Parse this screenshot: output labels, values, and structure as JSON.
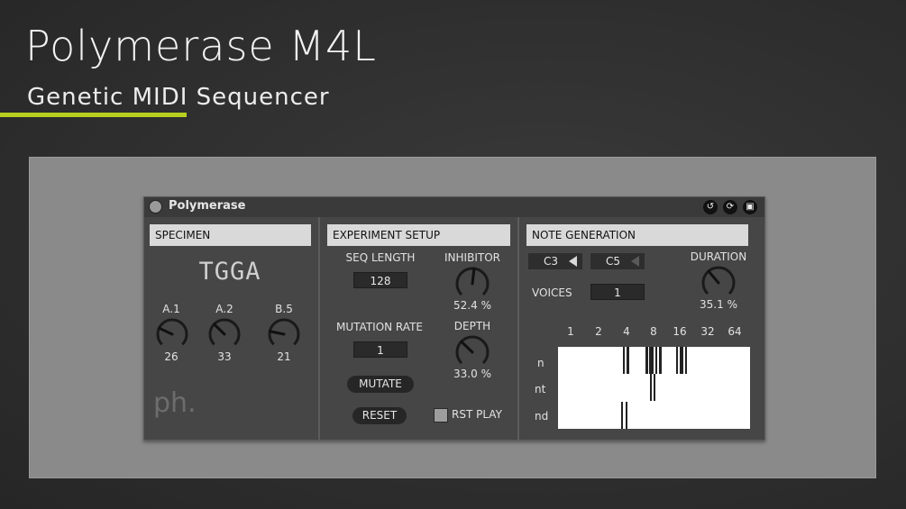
{
  "page": {
    "title": "Polymerase M4L",
    "subtitle": "Genetic MIDI Sequencer",
    "accent_color": "#b8cf1f"
  },
  "device": {
    "name": "Polymerase",
    "titlebar_icons": [
      "loop-icon",
      "refresh-icon",
      "save-icon"
    ]
  },
  "specimen": {
    "header": "SPECIMEN",
    "sequence": "TGGA",
    "knobs": [
      {
        "label": "A.1",
        "value": "26",
        "fraction": 0.26
      },
      {
        "label": "A.2",
        "value": "33",
        "fraction": 0.33
      },
      {
        "label": "B.5",
        "value": "21",
        "fraction": 0.21
      }
    ],
    "logo": "ph."
  },
  "experiment": {
    "header": "EXPERIMENT SETUP",
    "seq_length_label": "SEQ LENGTH",
    "seq_length_value": "128",
    "mutation_rate_label": "MUTATION RATE",
    "mutation_rate_value": "1",
    "inhibitor_label": "INHIBITOR",
    "inhibitor_value": "52.4 %",
    "inhibitor_fraction": 0.524,
    "depth_label": "DEPTH",
    "depth_value": "33.0 %",
    "depth_fraction": 0.33,
    "mutate_label": "MUTATE",
    "reset_label": "RESET",
    "rst_play_label": "RST PLAY",
    "rst_play_checked": false
  },
  "note_generation": {
    "header": "NOTE GENERATION",
    "low_note": "C3",
    "high_note": "C5",
    "voices_label": "VOICES",
    "voices_value": "1",
    "duration_label": "DURATION",
    "duration_value": "35.1 %",
    "duration_fraction": 0.351,
    "columns": [
      "1",
      "2",
      "4",
      "8",
      "16",
      "32",
      "64"
    ],
    "rows": [
      "n",
      "nt",
      "nd"
    ]
  }
}
